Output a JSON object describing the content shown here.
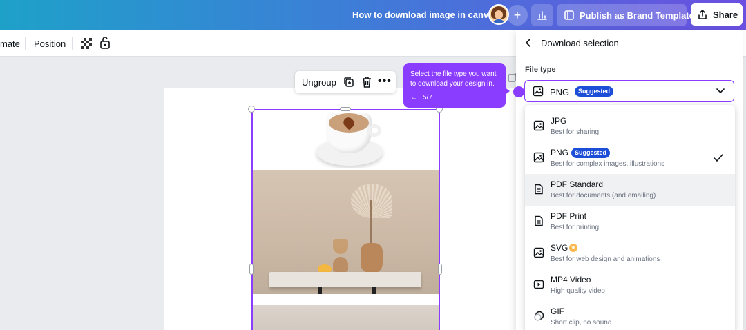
{
  "header": {
    "doc_title": "How to download image in canva",
    "publish_label": "Publish as Brand Template",
    "share_label": "Share",
    "plus_label": "+"
  },
  "toolbar": {
    "animate_label": "mate",
    "position_label": "Position"
  },
  "float_toolbar": {
    "ungroup_label": "Ungroup",
    "more_label": "•••"
  },
  "tooltip": {
    "text": "Select the file type you want to download your design in.",
    "back_label": "←",
    "step": "5/7"
  },
  "panel": {
    "title": "Download selection",
    "file_type_label": "File type",
    "selected_value": "PNG",
    "suggested_label": "Suggested",
    "options": [
      {
        "name": "JPG",
        "desc": "Best for sharing",
        "icon": "image-icon"
      },
      {
        "name": "PNG",
        "desc": "Best for complex images, illustrations",
        "icon": "image-icon",
        "badge": "Suggested",
        "selected": true
      },
      {
        "name": "PDF Standard",
        "desc": "Best for documents (and emailing)",
        "icon": "document-icon"
      },
      {
        "name": "PDF Print",
        "desc": "Best for printing",
        "icon": "document-icon"
      },
      {
        "name": "SVG",
        "desc": "Best for web design and animations",
        "icon": "image-icon",
        "pro": true
      },
      {
        "name": "MP4 Video",
        "desc": "High quality video",
        "icon": "video-icon"
      },
      {
        "name": "GIF",
        "desc": "Short clip, no sound",
        "icon": "gif-icon"
      }
    ]
  },
  "colors": {
    "accent": "#8b3dff",
    "badge": "#1d4ed8",
    "pro": "#f8b84e"
  }
}
